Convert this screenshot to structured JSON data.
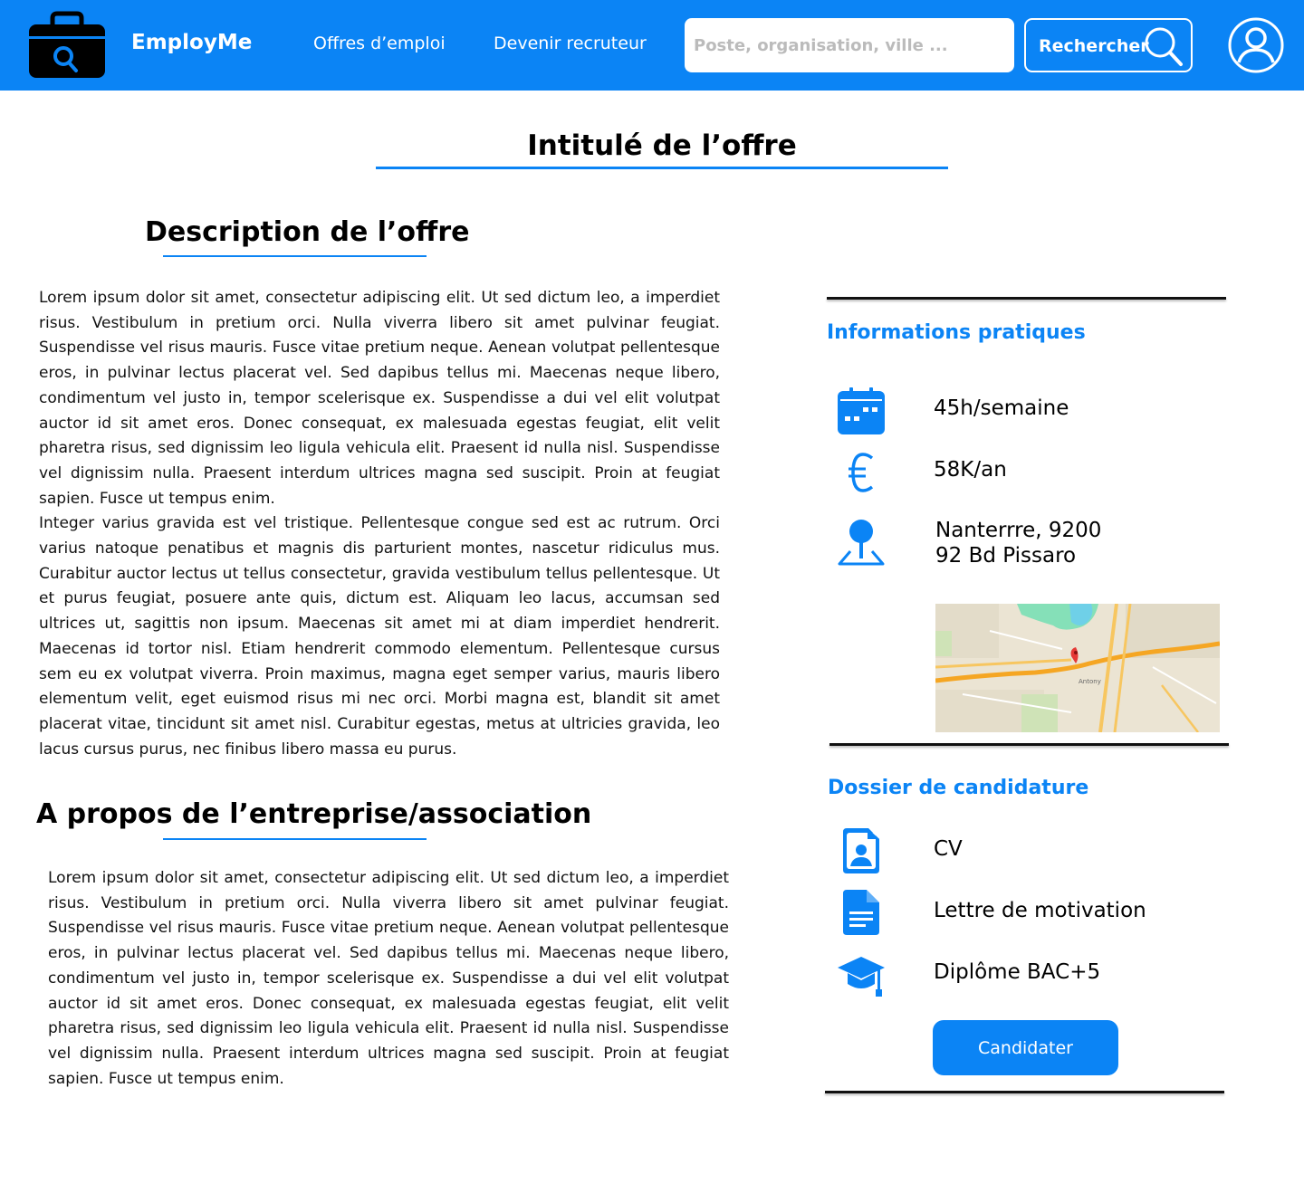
{
  "header": {
    "brand": "EmployMe",
    "nav": {
      "offres": "Offres d’emploi",
      "recruteur": "Devenir recruteur"
    },
    "search": {
      "placeholder": "Poste, organisation, ville ...",
      "value": "",
      "button_label": "Rechercher"
    },
    "icons": {
      "logo": "briefcase-search-icon",
      "search": "magnifier-icon",
      "account": "user-circle-icon"
    }
  },
  "page_title": "Intitulé de l’offre",
  "description": {
    "title": "Description de l’offre",
    "text": "Lorem ipsum dolor sit amet, consectetur adipiscing elit. Ut sed dictum leo, a imperdiet risus. Vestibulum in pretium orci. Nulla viverra libero sit amet pulvinar feugiat. Suspendisse vel risus mauris. Fusce vitae pretium neque. Aenean volutpat pellentesque eros, in pulvinar lectus placerat vel. Sed dapibus tellus mi. Maecenas neque libero, condimentum vel justo in, tempor scelerisque ex. Suspendisse a dui vel elit volutpat auctor id sit amet eros. Donec consequat, ex malesuada egestas feugiat, elit velit pharetra risus, sed dignissim leo ligula vehicula elit. Praesent id nulla nisl. Suspendisse vel dignissim nulla. Praesent interdum ultrices magna sed suscipit. Proin at feugiat sapien. Fusce ut tempus enim.\nInteger varius gravida est vel tristique. Pellentesque congue sed est ac rutrum. Orci varius natoque penatibus et magnis dis parturient montes, nascetur ridiculus mus. Curabitur auctor lectus ut tellus consectetur, gravida vestibulum tellus pellentesque. Ut et purus feugiat, posuere ante quis, dictum est. Aliquam leo lacus, accumsan sed ultrices ut, sagittis non ipsum. Maecenas sit amet mi at diam imperdiet hendrerit. Maecenas id tortor nisl. Etiam hendrerit commodo elementum. Pellentesque cursus sem eu ex volutpat viverra. Proin maximus, magna eget semper varius, mauris libero elementum velit, eget euismod risus mi nec orci. Morbi magna est, blandit sit amet placerat vitae, tincidunt sit amet nisl. Curabitur egestas, metus at ultricies gravida, leo lacus cursus purus, nec finibus libero massa eu purus."
  },
  "about": {
    "title": "A propos de l’entreprise/association",
    "text": "Lorem ipsum dolor sit amet, consectetur adipiscing elit. Ut sed dictum leo, a imperdiet risus. Vestibulum in pretium orci. Nulla viverra libero sit amet pulvinar feugiat. Suspendisse vel risus mauris. Fusce vitae pretium neque. Aenean volutpat pellentesque eros, in pulvinar lectus placerat vel. Sed dapibus tellus mi. Maecenas neque libero, condimentum vel justo in, tempor scelerisque ex. Suspendisse a dui vel elit volutpat auctor id sit amet eros. Donec consequat, ex malesuada egestas feugiat, elit velit pharetra risus, sed dignissim leo ligula vehicula elit. Praesent id nulla nisl. Suspendisse vel dignissim nulla. Praesent interdum ultrices magna sed suscipit. Proin at feugiat sapien. Fusce ut tempus enim."
  },
  "infos": {
    "title": "Informations pratiques",
    "hours": "45h/semaine",
    "salary": "58K/an",
    "address_line1": "Nanterrre, 9200",
    "address_line2": "92 Bd Pissaro",
    "icons": {
      "hours": "calendar-icon",
      "salary": "euro-icon",
      "address": "location-pin-icon"
    },
    "map": {
      "label": "Antony"
    }
  },
  "dossier": {
    "title": "Dossier de candidature",
    "items": [
      "CV",
      "Lettre de motivation",
      "Diplôme BAC+5"
    ],
    "icons": [
      "cv-document-icon",
      "text-document-icon",
      "graduation-cap-icon"
    ],
    "apply_label": "Candidater"
  },
  "colors": {
    "accent": "#0b84f5",
    "text": "#000000",
    "white": "#ffffff"
  }
}
